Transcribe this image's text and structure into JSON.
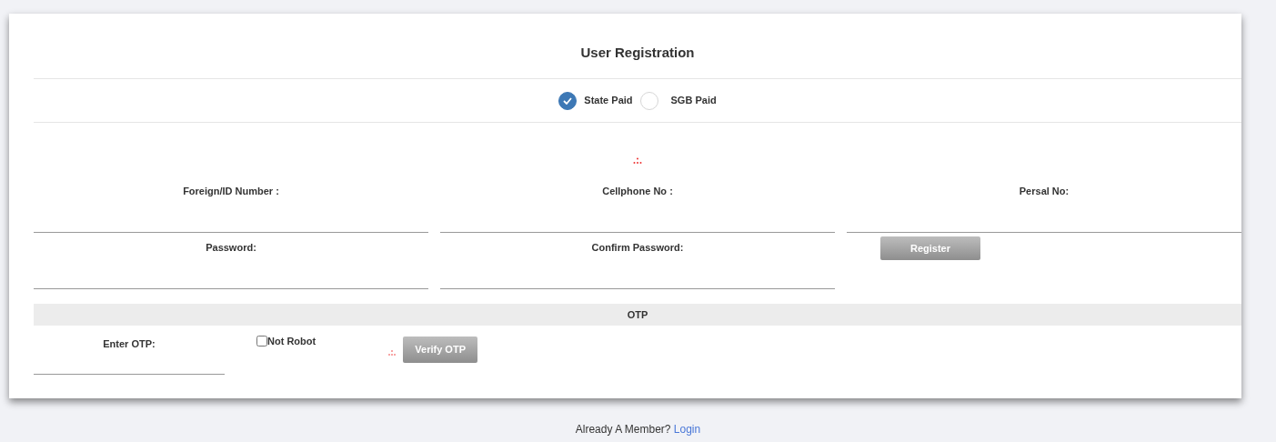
{
  "title": "User Registration",
  "payment_options": [
    {
      "label": "State Paid",
      "selected": true
    },
    {
      "label": "SGB Paid",
      "selected": false
    }
  ],
  "fields_row_1": [
    {
      "label": "Foreign/ID Number :"
    },
    {
      "label": "Cellphone No :"
    },
    {
      "label": "Persal No:"
    }
  ],
  "fields_row_2": [
    {
      "label": "Password:"
    },
    {
      "label": "Confirm Password:"
    }
  ],
  "register_button": "Register",
  "otp_section": {
    "heading": "OTP",
    "label": "Enter OTP:",
    "robot_checkbox": {
      "label": "Not Robot",
      "checked": false
    },
    "verify_button": "Verify OTP"
  },
  "footer": {
    "text": "Already A Member?",
    "link": "Login"
  }
}
